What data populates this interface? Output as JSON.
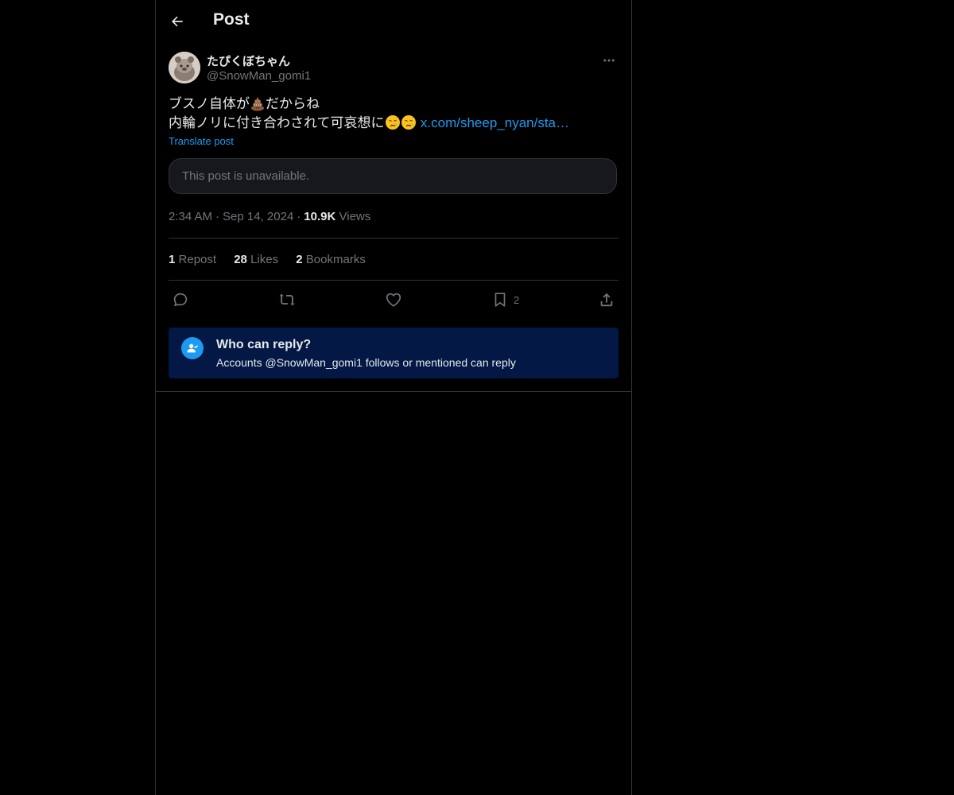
{
  "header": {
    "title": "Post"
  },
  "post": {
    "author": {
      "display_name": "たぴくぼちゃん",
      "handle": "@SnowMan_gomi1"
    },
    "text_line1_a": "ブスノ自体が",
    "text_line1_b": "だからね",
    "text_line2": "内輪ノリに付き合わされて可哀想に",
    "link": "x.com/sheep_nyan/sta…",
    "translate_label": "Translate post",
    "quoted_unavailable": "This post is unavailable.",
    "time": "2:34 AM",
    "date": "Sep 14, 2024",
    "views_count": "10.9K",
    "views_label": "Views",
    "stats": {
      "reposts_count": "1",
      "reposts_label": "Repost",
      "likes_count": "28",
      "likes_label": "Likes",
      "bookmarks_count": "2",
      "bookmarks_label": "Bookmarks"
    },
    "actions": {
      "bookmark_count": "2"
    },
    "icons": [
      "back-arrow-icon",
      "more-icon",
      "poop-emoji-icon",
      "crying-face-emoji-icon",
      "reply-icon",
      "repost-icon",
      "like-icon",
      "bookmark-icon",
      "share-icon",
      "person-check-icon"
    ]
  },
  "reply_restriction": {
    "title": "Who can reply?",
    "subtitle": "Accounts @SnowMan_gomi1 follows or mentioned can reply"
  },
  "colors": {
    "background": "#000000",
    "accent": "#1d9bf0",
    "muted": "#71767b",
    "reply_banner": "#031845"
  }
}
